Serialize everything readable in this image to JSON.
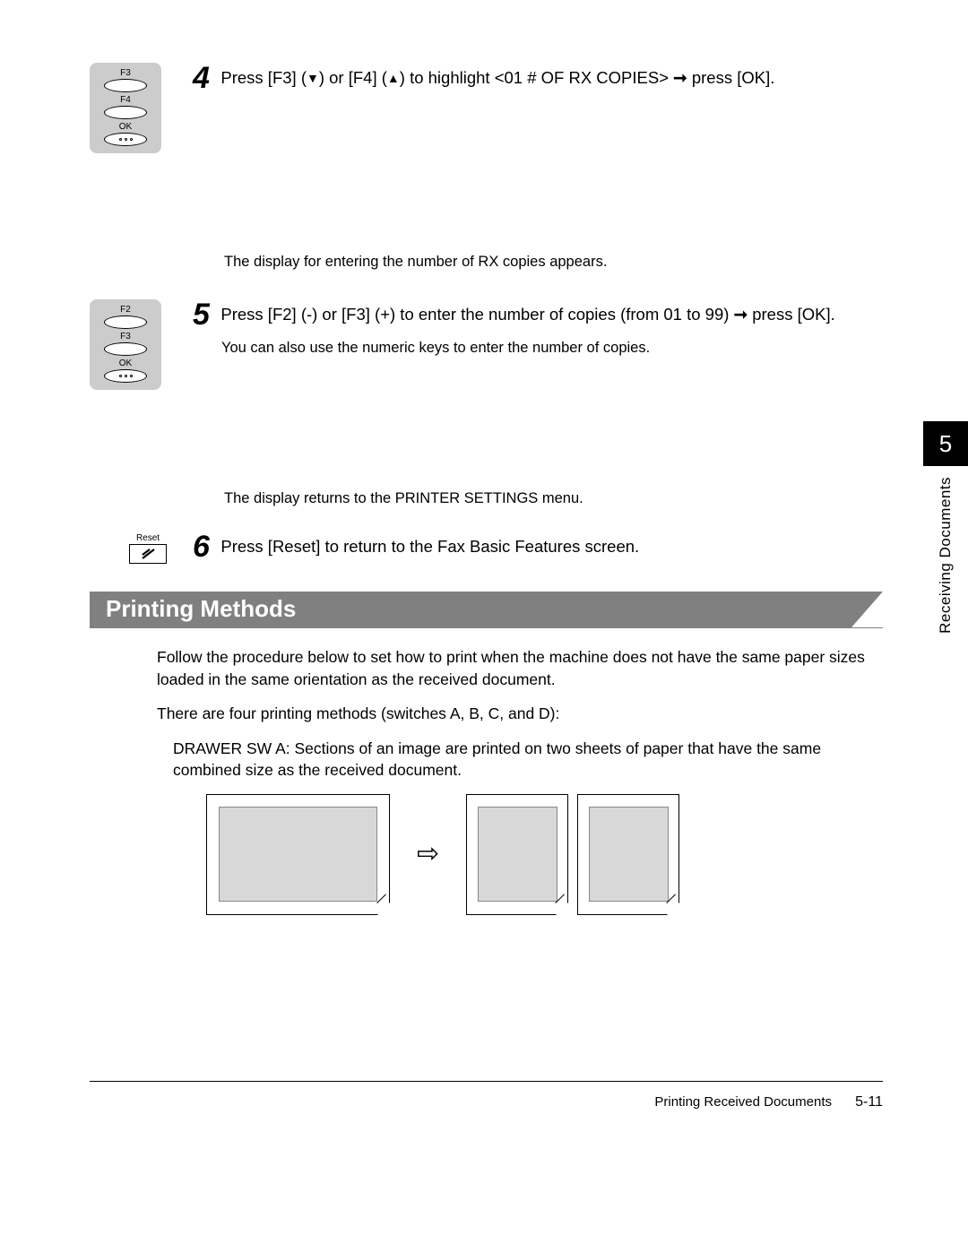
{
  "step4": {
    "number": "4",
    "keys": {
      "f3": "F3",
      "f4": "F4",
      "ok": "OK"
    },
    "text_a": "Press [F3] (",
    "text_b": ") or [F4] (",
    "text_c": ") to highlight <01 # OF RX COPIES> ",
    "text_d": " press [OK].",
    "after": "The display for entering the number of RX copies appears."
  },
  "step5": {
    "number": "5",
    "keys": {
      "f2": "F2",
      "f3": "F3",
      "ok": "OK"
    },
    "text_a": "Press [F2] (-) or [F3] (+) to enter the number of copies (from 01 to 99) ",
    "text_b": " press [OK].",
    "note": "You can also use the numeric keys to enter the number of copies.",
    "after": "The display returns to the PRINTER SETTINGS menu."
  },
  "step6": {
    "number": "6",
    "resetLabel": "Reset",
    "text": "Press [Reset] to return to the Fax Basic Features screen."
  },
  "section": {
    "title": "Printing Methods",
    "p1": "Follow the procedure below to set how to print when the machine does not have the same paper sizes loaded in the same orientation as the received document.",
    "p2": "There are four printing methods (switches A, B, C, and D):",
    "p3": "DRAWER SW A: Sections of an image are printed on two sheets of paper that have the same combined size as the received document."
  },
  "sidebar": {
    "chapter": "5",
    "title": "Receiving Documents"
  },
  "footer": {
    "title": "Printing Received Documents",
    "page": "5-11"
  }
}
